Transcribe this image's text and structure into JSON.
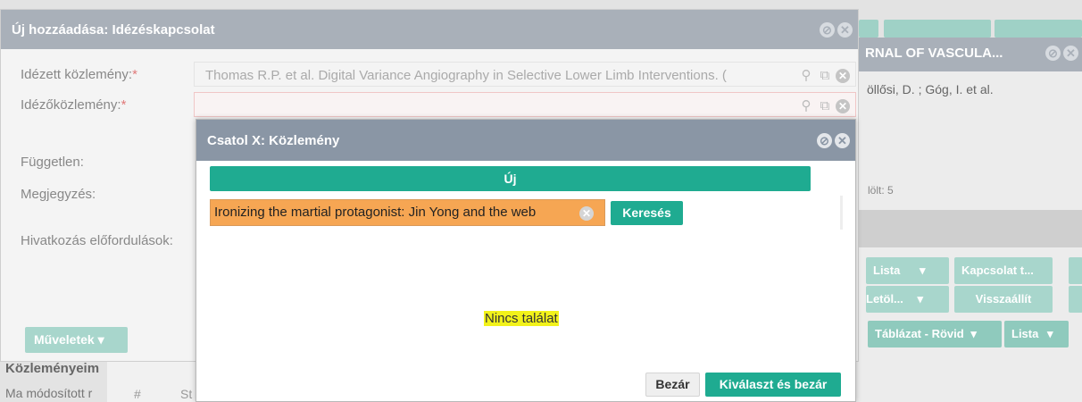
{
  "background": {
    "right_panel": {
      "header_title": "RNAL OF VASCULA...",
      "authors": "öllősi, D. ; Góg, I. et al.",
      "count": "lölt: 5",
      "buttons_row1": [
        "Lista",
        "Kapcsolat t..."
      ],
      "buttons_row2": [
        "Letöl...",
        "Visszaállít"
      ],
      "buttons_row3": [
        "Táblázat - Rövid",
        "Lista"
      ]
    },
    "left": {
      "section_title": "Közleményeim",
      "modified_label": "Ma módosított r",
      "table_hash": "#",
      "table_st": "St"
    }
  },
  "modal1": {
    "title": "Új hozzáadása: Idézéskapcsolat",
    "fields": {
      "cited_label": "Idézett közlemény:",
      "cited_value": "Thomas R.P. et al. Digital Variance Angiography in Selective Lower Limb Interventions. (",
      "citing_label": "Idézőközlemény:",
      "citing_value": "",
      "independent_label": "Független:",
      "note_label": "Megjegyzés:",
      "occurrences_label": "Hivatkozás előfordulások:"
    },
    "required_mark": "*",
    "operations_button": "Műveletek ▾"
  },
  "modal2": {
    "title": "Csatol X: Közlemény",
    "new_button": "Új",
    "search_value": "Ironizing the martial protagonist: Jin Yong and the web",
    "search_button": "Keresés",
    "no_results": "Nincs találat",
    "close_button": "Bezár",
    "select_close_button": "Kiválaszt és bezár"
  },
  "icons": {
    "search": "search-icon",
    "open_external": "open-external-icon",
    "clear": "clear-icon",
    "minimize": "minimize-icon",
    "close": "close-icon"
  },
  "colors": {
    "accent_green": "#1fab91",
    "modal_header": "#8a96a5",
    "search_highlight": "#f6a653",
    "no_result_highlight": "#f2f21a"
  }
}
